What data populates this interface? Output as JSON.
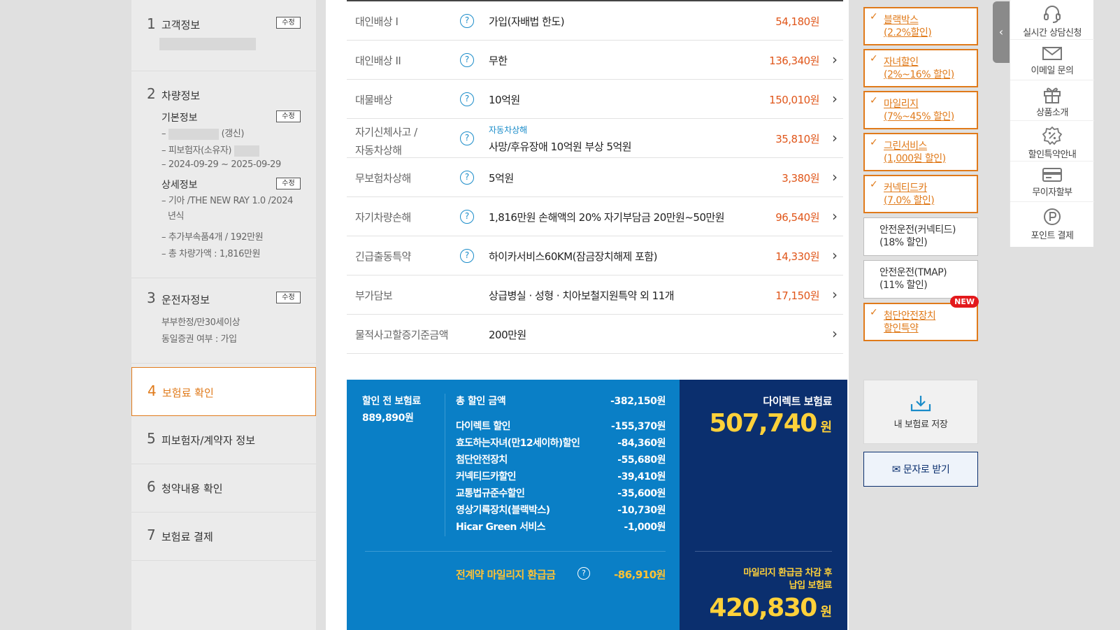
{
  "steps": {
    "s1": {
      "num": "1",
      "title": "고객정보",
      "edit": "수정"
    },
    "s2": {
      "num": "2",
      "title": "차량정보",
      "basic": {
        "title": "기본정보",
        "edit": "수정",
        "line1_suffix": "(갱신)",
        "line2": "피보험자(소유자)",
        "line3": "2024-09-29 ~ 2025-09-29"
      },
      "detail": {
        "title": "상세정보",
        "edit": "수정",
        "line1": "기아 /THE NEW RAY 1.0 /2024",
        "line1b": "년식",
        "line2": "추가부속품4개 / 192만원",
        "line3": "총 차량가액 : 1,816만원"
      }
    },
    "s3": {
      "num": "3",
      "title": "운전자정보",
      "edit": "수정",
      "line1": "부부한정/만30세이상",
      "line2": "동일증권 여부 : 가입"
    },
    "s4": {
      "num": "4",
      "title": "보험료 확인"
    },
    "s5": {
      "num": "5",
      "title": "피보험자/계약자 정보"
    },
    "s6": {
      "num": "6",
      "title": "청약내용 확인"
    },
    "s7": {
      "num": "7",
      "title": "보험료 결제"
    }
  },
  "coverage": [
    {
      "label": "대인배상 I",
      "help": "?",
      "value": "가입(자배법 한도)",
      "price": "54,180원",
      "chev": ""
    },
    {
      "label": "대인배상 II",
      "help": "?",
      "value": "무한",
      "price": "136,340원",
      "chev": "›"
    },
    {
      "label": "대물배상",
      "help": "?",
      "value": "10억원",
      "price": "150,010원",
      "chev": "›"
    },
    {
      "label": "자기신체사고 /",
      "label2": "자동차상해",
      "help": "?",
      "tag": "자동차상해",
      "value": "사망/후유장애 10억원 부상 5억원",
      "price": "35,810원",
      "chev": "›"
    },
    {
      "label": "무보험차상해",
      "help": "?",
      "value": "5억원",
      "price": "3,380원",
      "chev": "›"
    },
    {
      "label": "자기차량손해",
      "help": "?",
      "value": "1,816만원 손해액의 20% 자기부담금 20만원~50만원",
      "price": "96,540원",
      "chev": "›"
    },
    {
      "label": "긴급출동특약",
      "help": "?",
      "value": "하이카서비스60KM(잠금장치해제 포함)",
      "price": "14,330원",
      "chev": "›"
    },
    {
      "label": "부가담보",
      "value": "상급병실 · 성형 · 치아보철지원특약 외 11개",
      "price": "17,150원",
      "chev": "›"
    },
    {
      "label": "물적사고할증기준금액",
      "value": "200만원",
      "price": "",
      "chev": "›"
    }
  ],
  "summary": {
    "pre_label": "할인 전 보험료",
    "pre_value": "889,890원",
    "total_label": "총 할인 금액",
    "total_value": "-382,150원",
    "discounts": [
      {
        "label": "다이렉트 할인",
        "value": "-155,370원"
      },
      {
        "label": "효도하는자녀(만12세이하)할인",
        "value": "-84,360원"
      },
      {
        "label": "첨단안전장치",
        "value": "-55,680원"
      },
      {
        "label": "커넥티드카할인",
        "value": "-39,410원"
      },
      {
        "label": "교통법규준수할인",
        "value": "-35,600원"
      },
      {
        "label": "영상기록장치(블랙박스)",
        "value": "-10,730원"
      },
      {
        "label": "Hicar Green 서비스",
        "value": "-1,000원"
      }
    ],
    "mileage_label": "전계약 마일리지 환급금",
    "mileage_help": "?",
    "mileage_value": "-86,910원",
    "direct_label": "다이렉트 보험료",
    "direct_value": "507,740",
    "direct_unit": "원",
    "after_label1": "마일리지 환급금 차감 후",
    "after_label2": "납입 보험료",
    "after_value": "420,830",
    "after_unit": "원"
  },
  "options": [
    {
      "checked": true,
      "line1": "블랙박스",
      "line2": "(2.2%할인)"
    },
    {
      "checked": true,
      "line1": "자녀할인",
      "line2": "(2%~16% 할인)"
    },
    {
      "checked": true,
      "line1": "마일리지",
      "line2": "(7%~45% 할인)"
    },
    {
      "checked": true,
      "line1": "그린서비스",
      "line2": "(1,000원 할인)"
    },
    {
      "checked": true,
      "line1": "커넥티드카",
      "line2": "(7.0% 할인)"
    },
    {
      "checked": false,
      "line1": "안전운전(커넥티드)",
      "line2": "(18% 할인)"
    },
    {
      "checked": false,
      "line1": "안전운전(TMAP)",
      "line2": "(11% 할인)"
    },
    {
      "checked": true,
      "line1": "첨단안전장치",
      "line2": "할인특약",
      "badge": "NEW"
    }
  ],
  "check_glyph": "✓",
  "actions": {
    "save": "내 보험료 저장",
    "sms": "문자로 받기"
  },
  "quick_tab": "‹",
  "quick": [
    {
      "icon": "headset-icon",
      "label": "실시간 상담신청"
    },
    {
      "icon": "mail-icon",
      "label": "이메일 문의"
    },
    {
      "icon": "gift-icon",
      "label": "상품소개"
    },
    {
      "icon": "discount-badge-icon",
      "label": "할인특약안내"
    },
    {
      "icon": "card-icon",
      "label": "무이자할부"
    },
    {
      "icon": "point-icon",
      "label": "포인트 결제"
    }
  ],
  "colors": {
    "accent_orange": "#e07a1a",
    "price_red": "#e0561a",
    "blue": "#0a7fc6",
    "navy": "#0b2f6e",
    "yellow": "#ffd13a"
  }
}
